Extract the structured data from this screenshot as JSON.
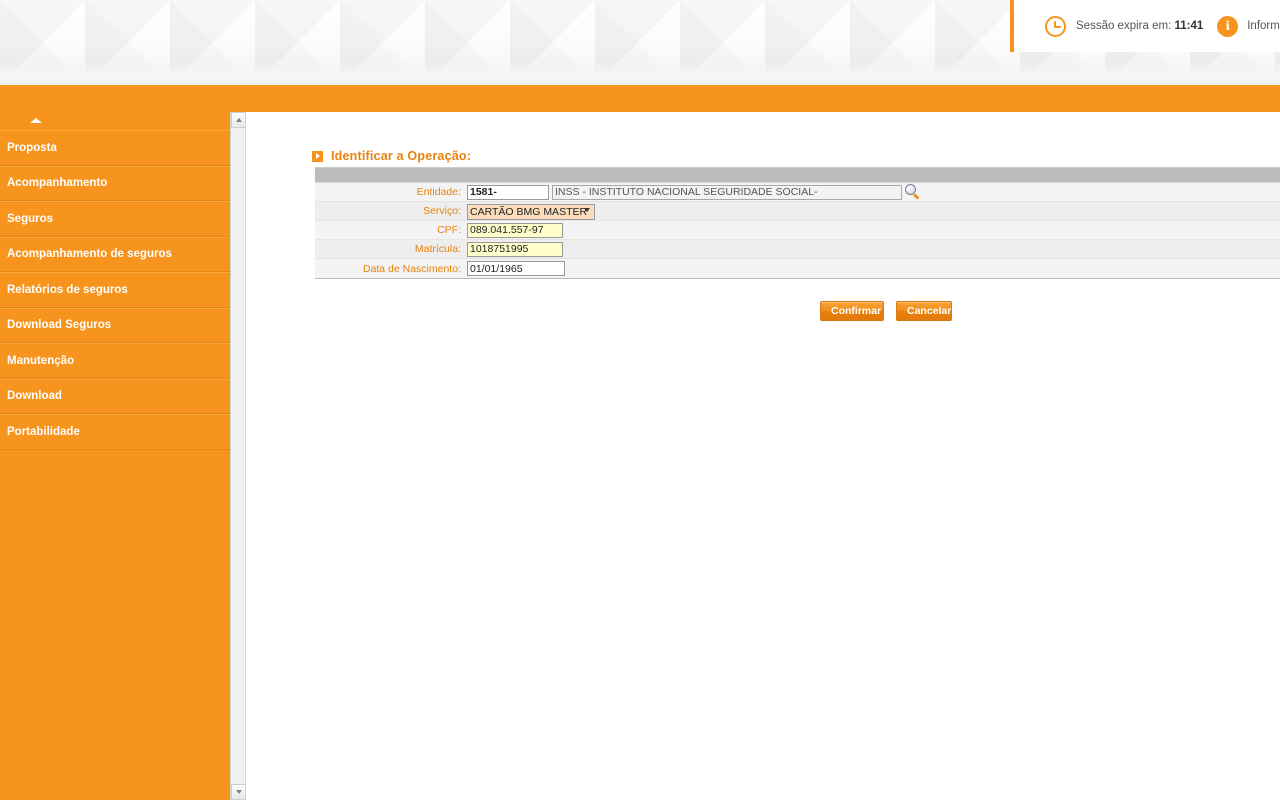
{
  "topbar": {
    "clock_icon": "clock-icon",
    "session_label": "Sessão expira em:",
    "session_time": "11:41",
    "info_icon": "info-icon",
    "info_label": "Informações"
  },
  "sidebar": {
    "collapse_icon": "caret-up-icon",
    "items": [
      {
        "label": "Proposta"
      },
      {
        "label": "Acompanhamento"
      },
      {
        "label": "Seguros"
      },
      {
        "label": "Acompanhamento de seguros"
      },
      {
        "label": "Relatórios de seguros"
      },
      {
        "label": "Download Seguros"
      },
      {
        "label": "Manutenção"
      },
      {
        "label": "Download"
      },
      {
        "label": "Portabilidade"
      }
    ]
  },
  "main": {
    "section_title": "Identificar a Operação:",
    "fields": {
      "entidade_label": "Entidade:",
      "entidade_code": "1581-",
      "entidade_name": "INSS - INSTITUTO NACIONAL SEGURIDADE SOCIAL-",
      "search_icon": "magnifier-icon",
      "servico_label": "Serviço:",
      "servico_value": "CARTÃO BMG MASTER",
      "cpf_label": "CPF:",
      "cpf_value": "089.041.557-97",
      "matricula_label": "Matrícula:",
      "matricula_value": "1018751995",
      "nascimento_label": "Data de Nascimento:",
      "nascimento_value": "01/01/1965"
    },
    "buttons": {
      "confirm": "Confirmar",
      "cancel": "Cancelar"
    }
  },
  "colors": {
    "brand_orange": "#f7941e",
    "label_orange": "#e8820c",
    "required_field": "#ffffcc",
    "select_bg": "#fbddbb",
    "table_header": "#bcbcbc"
  }
}
